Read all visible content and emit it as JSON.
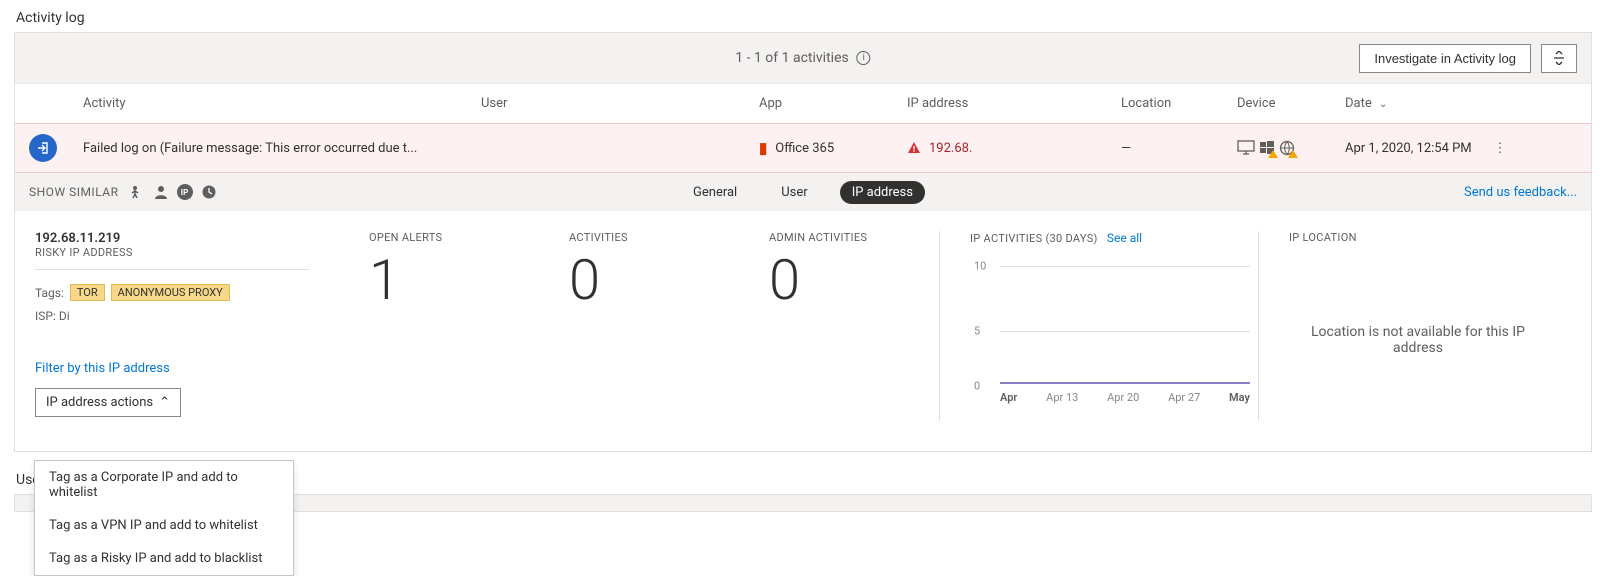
{
  "section_title": "Activity log",
  "pagination_text": "1 - 1 of 1 activities",
  "buttons": {
    "investigate": "Investigate in Activity log"
  },
  "columns": {
    "activity": "Activity",
    "user": "User",
    "app": "App",
    "ip": "IP address",
    "location": "Location",
    "device": "Device",
    "date": "Date"
  },
  "event": {
    "activity": "Failed log on (Failure message: This error occurred due t...",
    "user": "",
    "app": "Office 365",
    "ip": "192.68.",
    "location": "—",
    "date": "Apr 1, 2020, 12:54 PM"
  },
  "subbar": {
    "show_similar": "SHOW SIMILAR",
    "tabs": {
      "general": "General",
      "user": "User",
      "ip": "IP address"
    },
    "feedback": "Send us feedback..."
  },
  "ipinfo": {
    "ip": "192.68.11.219",
    "label": "RISKY IP ADDRESS",
    "tags_label": "Tags:",
    "tags": [
      "TOR",
      "ANONYMOUS PROXY"
    ],
    "isp_label": "ISP: Di",
    "filter_link": "Filter by this IP address",
    "actions_label": "IP address actions"
  },
  "actions_menu": [
    "Tag as a Corporate IP and add to whitelist",
    "Tag as a VPN IP and add to whitelist",
    "Tag as a Risky IP and add to blacklist"
  ],
  "stats": {
    "open_alerts": {
      "title": "OPEN ALERTS",
      "value": "1"
    },
    "activities": {
      "title": "ACTIVITIES",
      "value": "0"
    },
    "admin_activities": {
      "title": "ADMIN ACTIVITIES",
      "value": "0"
    }
  },
  "chart": {
    "title": "IP ACTIVITIES (30 DAYS)",
    "see_all": "See all"
  },
  "chart_data": {
    "type": "line",
    "xlabel": "",
    "ylabel": "",
    "ylim": [
      0,
      10
    ],
    "yticks": [
      0,
      5,
      10
    ],
    "xticks": [
      "Apr",
      "Apr 13",
      "Apr 20",
      "Apr 27",
      "May"
    ],
    "series": [
      {
        "name": "IP activities",
        "values": [
          0,
          0,
          0,
          0,
          0
        ]
      }
    ]
  },
  "iplocation": {
    "title": "IP LOCATION",
    "message": "Location is not available for this IP address"
  },
  "lower_section_title": "User"
}
